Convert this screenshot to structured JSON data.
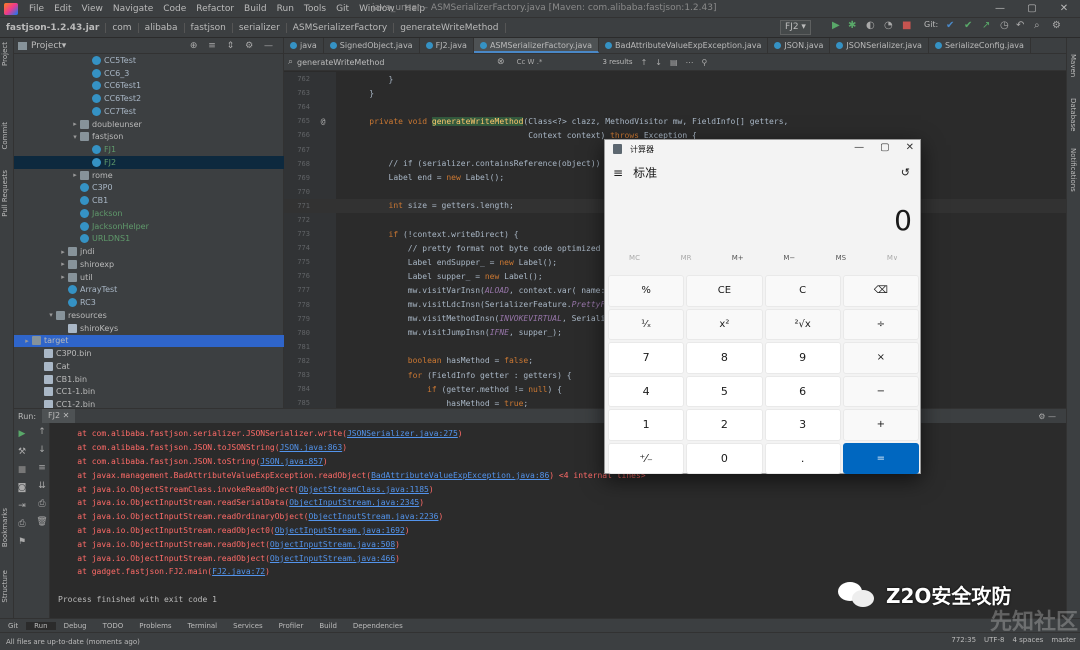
{
  "window": {
    "menu": [
      "File",
      "Edit",
      "View",
      "Navigate",
      "Code",
      "Refactor",
      "Build",
      "Run",
      "Tools",
      "Git",
      "Window",
      "Help"
    ],
    "title": "java_unser – ASMSerializerFactory.java [Maven: com.alibaba:fastjson:1.2.43]",
    "controls": [
      "—",
      "▢",
      "✕"
    ]
  },
  "breadcrumbs": [
    "fastjson-1.2.43.jar",
    "com",
    "alibaba",
    "fastjson",
    "serializer",
    "ASMSerializerFactory",
    "generateWriteMethod"
  ],
  "run_config": "FJ2",
  "git_label": "Git:",
  "left_tools": [
    "Project",
    "Commit",
    "Pull Requests",
    "Bookmarks",
    "Structure"
  ],
  "right_tools": [
    "Maven",
    "Database",
    "Notifications"
  ],
  "project": {
    "header": "Project",
    "tree": [
      {
        "depth": 5,
        "label": "CC5Test",
        "type": "cls"
      },
      {
        "depth": 5,
        "label": "CC6_3",
        "type": "cls"
      },
      {
        "depth": 5,
        "label": "CC6Test1",
        "type": "cls"
      },
      {
        "depth": 5,
        "label": "CC6Test2",
        "type": "cls"
      },
      {
        "depth": 5,
        "label": "CC7Test",
        "type": "cls"
      },
      {
        "depth": 4,
        "label": "doubleunser",
        "type": "folder",
        "arrow": "▸"
      },
      {
        "depth": 4,
        "label": "fastjson",
        "type": "folder",
        "arrow": "▾"
      },
      {
        "depth": 5,
        "label": "FJ1",
        "type": "cls"
      },
      {
        "depth": 5,
        "label": "FJ2",
        "type": "cls",
        "selected": true
      },
      {
        "depth": 4,
        "label": "rome",
        "type": "folder",
        "arrow": "▸"
      },
      {
        "depth": 4,
        "label": "C3P0",
        "type": "cls"
      },
      {
        "depth": 4,
        "label": "CB1",
        "type": "cls"
      },
      {
        "depth": 4,
        "label": "Jackson",
        "type": "cls"
      },
      {
        "depth": 4,
        "label": "JacksonHelper",
        "type": "cls"
      },
      {
        "depth": 4,
        "label": "URLDNS1",
        "type": "cls"
      },
      {
        "depth": 3,
        "label": "jndi",
        "type": "folder",
        "arrow": "▸"
      },
      {
        "depth": 3,
        "label": "shiroexp",
        "type": "folder",
        "arrow": "▸"
      },
      {
        "depth": 3,
        "label": "util",
        "type": "folder",
        "arrow": "▸"
      },
      {
        "depth": 3,
        "label": "ArrayTest",
        "type": "cls"
      },
      {
        "depth": 3,
        "label": "RC3",
        "type": "cls"
      },
      {
        "depth": 2,
        "label": "resources",
        "type": "folder",
        "arrow": "▾"
      },
      {
        "depth": 3,
        "label": "shiroKeys",
        "type": "file"
      },
      {
        "depth": 0,
        "label": "target",
        "type": "folder",
        "arrow": "▸",
        "highlight": true
      },
      {
        "depth": 1,
        "label": "C3P0.bin",
        "type": "file"
      },
      {
        "depth": 1,
        "label": "Cat",
        "type": "file"
      },
      {
        "depth": 1,
        "label": "CB1.bin",
        "type": "file"
      },
      {
        "depth": 1,
        "label": "CC1-1.bin",
        "type": "file"
      },
      {
        "depth": 1,
        "label": "CC1-2.bin",
        "type": "file"
      }
    ]
  },
  "tabs": [
    {
      "label": "java",
      "active": false
    },
    {
      "label": "SignedObject.java",
      "active": false
    },
    {
      "label": "FJ2.java",
      "active": false
    },
    {
      "label": "ASMSerializerFactory.java",
      "active": true
    },
    {
      "label": "BadAttributeValueExpException.java",
      "active": false
    },
    {
      "label": "JSON.java",
      "active": false
    },
    {
      "label": "JSONSerializer.java",
      "active": false
    },
    {
      "label": "SerializeConfig.java",
      "active": false
    }
  ],
  "find": {
    "value": "generateWriteMethod",
    "flags": "Cc  W  .*",
    "results": "3 results"
  },
  "code": [
    {
      "n": "762",
      "t": "        }"
    },
    {
      "n": "763",
      "t": "    }"
    },
    {
      "n": "764",
      "t": ""
    },
    {
      "n": "765",
      "t": "    private void generateWriteMethod(Class<?> clazz, MethodVisitor mw, FieldInfo[] getters,",
      "g": "@"
    },
    {
      "n": "766",
      "t": "                                     Context context) throws Exception {"
    },
    {
      "n": "767",
      "t": ""
    },
    {
      "n": "768",
      "t": "        // if (serializer.containsReference(object))"
    },
    {
      "n": "769",
      "t": "        Label end = new Label();"
    },
    {
      "n": "770",
      "t": ""
    },
    {
      "n": "771",
      "t": "        int size = getters.length;",
      "cur": true
    },
    {
      "n": "772",
      "t": ""
    },
    {
      "n": "773",
      "t": "        if (!context.writeDirect) {"
    },
    {
      "n": "774",
      "t": "            // pretty format not byte code optimized"
    },
    {
      "n": "775",
      "t": "            Label endSupper_ = new Label();"
    },
    {
      "n": "776",
      "t": "            Label supper_ = new Label();"
    },
    {
      "n": "777",
      "t": "            mw.visitVarInsn(ALOAD, context.var( name: \"out\"));"
    },
    {
      "n": "778",
      "t": "            mw.visitLdcInsn(SerializerFeature.PrettyFormat.mask);"
    },
    {
      "n": "779",
      "t": "            mw.visitMethodInsn(INVOKEVIRTUAL, SerializeWriter, name: \"isEnabled\", desc: \"(I)Z\", itf: false);"
    },
    {
      "n": "780",
      "t": "            mw.visitJumpInsn(IFNE, supper_);"
    },
    {
      "n": "781",
      "t": ""
    },
    {
      "n": "782",
      "t": "            boolean hasMethod = false;"
    },
    {
      "n": "783",
      "t": "            for (FieldInfo getter : getters) {"
    },
    {
      "n": "784",
      "t": "                if (getter.method != null) {"
    },
    {
      "n": "785",
      "t": "                    hasMethod = true;"
    }
  ],
  "run": {
    "label": "Run:",
    "tab": "FJ2",
    "lines": [
      {
        "pre": "    at com.alibaba.fastjson.serializer.JSONSerializer.write(",
        "lk": "JSONSerializer.java:275",
        "post": ")"
      },
      {
        "pre": "    at com.alibaba.fastjson.JSON.toJSONString(",
        "lk": "JSON.java:863",
        "post": ")"
      },
      {
        "pre": "    at com.alibaba.fastjson.JSON.toString(",
        "lk": "JSON.java:857",
        "post": ")"
      },
      {
        "pre": "    at javax.management.BadAttributeValueExpException.readObject(",
        "lk": "BadAttributeValueExpException.java:86",
        "post": ") <4 internal lines>"
      },
      {
        "pre": "    at java.io.ObjectStreamClass.invokeReadObject(",
        "lk": "ObjectStreamClass.java:1185",
        "post": ")"
      },
      {
        "pre": "    at java.io.ObjectInputStream.readSerialData(",
        "lk": "ObjectInputStream.java:2345",
        "post": ")"
      },
      {
        "pre": "    at java.io.ObjectInputStream.readOrdinaryObject(",
        "lk": "ObjectInputStream.java:2236",
        "post": ")"
      },
      {
        "pre": "    at java.io.ObjectInputStream.readObject0(",
        "lk": "ObjectInputStream.java:1692",
        "post": ")"
      },
      {
        "pre": "    at java.io.ObjectInputStream.readObject(",
        "lk": "ObjectInputStream.java:508",
        "post": ")"
      },
      {
        "pre": "    at java.io.ObjectInputStream.readObject(",
        "lk": "ObjectInputStream.java:466",
        "post": ")"
      },
      {
        "pre": "    at gadget.fastjson.FJ2.main(",
        "lk": "FJ2.java:72",
        "post": ")"
      },
      {
        "pre": "",
        "lk": "",
        "post": ""
      },
      {
        "pre": "Process finished with exit code 1",
        "lk": "",
        "post": "",
        "plain": true
      }
    ]
  },
  "bottom_tabs": [
    "Git",
    "Run",
    "Debug",
    "TODO",
    "Problems",
    "Terminal",
    "Services",
    "Profiler",
    "Build",
    "Dependencies"
  ],
  "status": {
    "message": "All files are up-to-date (moments ago)",
    "position": "772:35",
    "encoding": "UTF-8",
    "indent": "4 spaces",
    "branch": "master"
  },
  "calculator": {
    "title": "计算器",
    "mode": "标准",
    "display": "0",
    "memory": [
      "MC",
      "MR",
      "M+",
      "M−",
      "MS",
      "M∨"
    ],
    "keys": [
      "%",
      "CE",
      "C",
      "⌫",
      "¹⁄ₓ",
      "x²",
      "²√x",
      "÷",
      "7",
      "8",
      "9",
      "×",
      "4",
      "5",
      "6",
      "−",
      "1",
      "2",
      "3",
      "+",
      "⁺⁄₋",
      "0",
      ".",
      "="
    ]
  },
  "watermark": {
    "text": "Z2O安全攻防",
    "bg": "先知社区"
  }
}
